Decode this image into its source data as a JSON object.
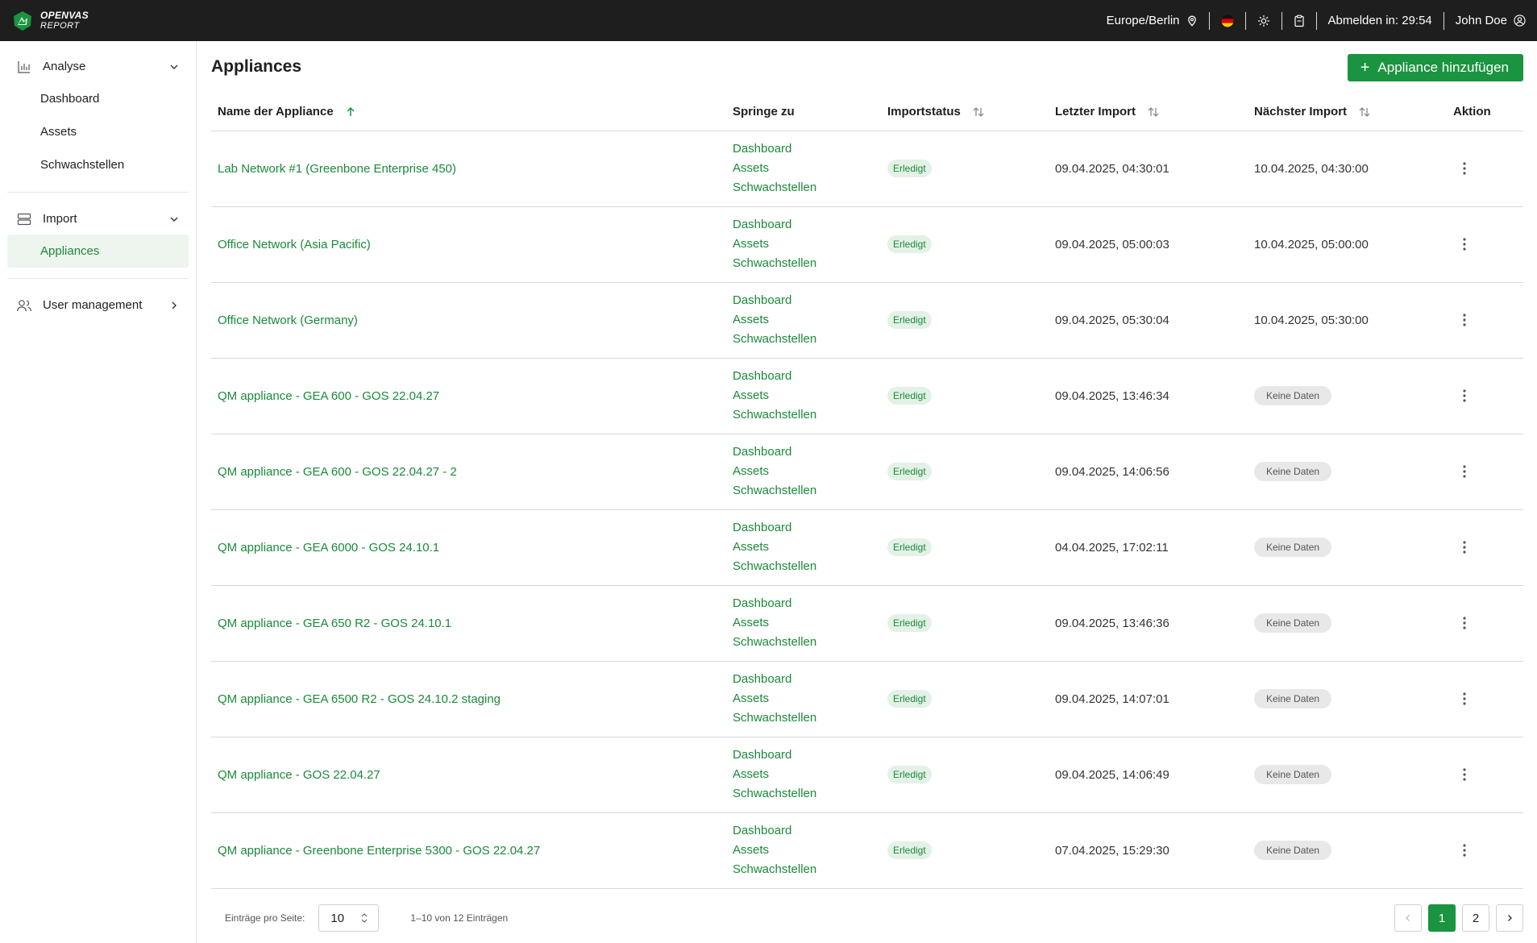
{
  "app": {
    "logo_line1": "OPENVAS",
    "logo_line2": "REPORT"
  },
  "topbar": {
    "timezone": "Europe/Berlin",
    "language": "de",
    "logout_label": "Abmelden in: 29:54",
    "user_name": "John Doe"
  },
  "sidebar": {
    "analyse": {
      "label": "Analyse",
      "items": [
        "Dashboard",
        "Assets",
        "Schwachstellen"
      ]
    },
    "import": {
      "label": "Import",
      "items": [
        "Appliances"
      ]
    },
    "user_management": {
      "label": "User management"
    }
  },
  "page": {
    "title": "Appliances",
    "add_button": "Appliance hinzufügen"
  },
  "table": {
    "headers": {
      "name": "Name der Appliance",
      "jump": "Springe zu",
      "status": "Importstatus",
      "last": "Letzter Import",
      "next": "Nächster Import",
      "action": "Aktion"
    },
    "jump_links": [
      "Dashboard",
      "Assets",
      "Schwachstellen"
    ],
    "rows": [
      {
        "name": "Lab Network #1 (Greenbone Enterprise 450)",
        "status": "Erledigt",
        "last": "09.04.2025, 04:30:01",
        "next": "10.04.2025, 04:30:00",
        "next_is_badge": false
      },
      {
        "name": "Office Network (Asia Pacific)",
        "status": "Erledigt",
        "last": "09.04.2025, 05:00:03",
        "next": "10.04.2025, 05:00:00",
        "next_is_badge": false
      },
      {
        "name": "Office Network (Germany)",
        "status": "Erledigt",
        "last": "09.04.2025, 05:30:04",
        "next": "10.04.2025, 05:30:00",
        "next_is_badge": false
      },
      {
        "name": "QM appliance - GEA 600 - GOS 22.04.27",
        "status": "Erledigt",
        "last": "09.04.2025, 13:46:34",
        "next": "Keine Daten",
        "next_is_badge": true
      },
      {
        "name": "QM appliance - GEA 600 - GOS 22.04.27 - 2",
        "status": "Erledigt",
        "last": "09.04.2025, 14:06:56",
        "next": "Keine Daten",
        "next_is_badge": true
      },
      {
        "name": "QM appliance - GEA 6000 - GOS 24.10.1",
        "status": "Erledigt",
        "last": "04.04.2025, 17:02:11",
        "next": "Keine Daten",
        "next_is_badge": true
      },
      {
        "name": "QM appliance - GEA 650 R2 - GOS 24.10.1",
        "status": "Erledigt",
        "last": "09.04.2025, 13:46:36",
        "next": "Keine Daten",
        "next_is_badge": true
      },
      {
        "name": "QM appliance - GEA 6500 R2 - GOS 24.10.2 staging",
        "status": "Erledigt",
        "last": "09.04.2025, 14:07:01",
        "next": "Keine Daten",
        "next_is_badge": true
      },
      {
        "name": "QM appliance - GOS 22.04.27",
        "status": "Erledigt",
        "last": "09.04.2025, 14:06:49",
        "next": "Keine Daten",
        "next_is_badge": true
      },
      {
        "name": "QM appliance - Greenbone Enterprise 5300 - GOS 22.04.27",
        "status": "Erledigt",
        "last": "07.04.2025, 15:29:30",
        "next": "Keine Daten",
        "next_is_badge": true
      }
    ]
  },
  "footer": {
    "per_page_label": "Einträge pro Seite:",
    "per_page_value": "10",
    "range": "1–10 von 12 Einträgen",
    "pages": [
      "1",
      "2"
    ],
    "current_page": "1"
  },
  "colors": {
    "accent": "#1a9440",
    "link": "#1a8a3a",
    "topbar": "#1e1e1e"
  },
  "icons": {
    "timezone": "location-pin-icon",
    "language": "german-flag-icon",
    "theme": "sun-icon",
    "notes": "clipboard-icon",
    "user": "user-circle-icon"
  }
}
